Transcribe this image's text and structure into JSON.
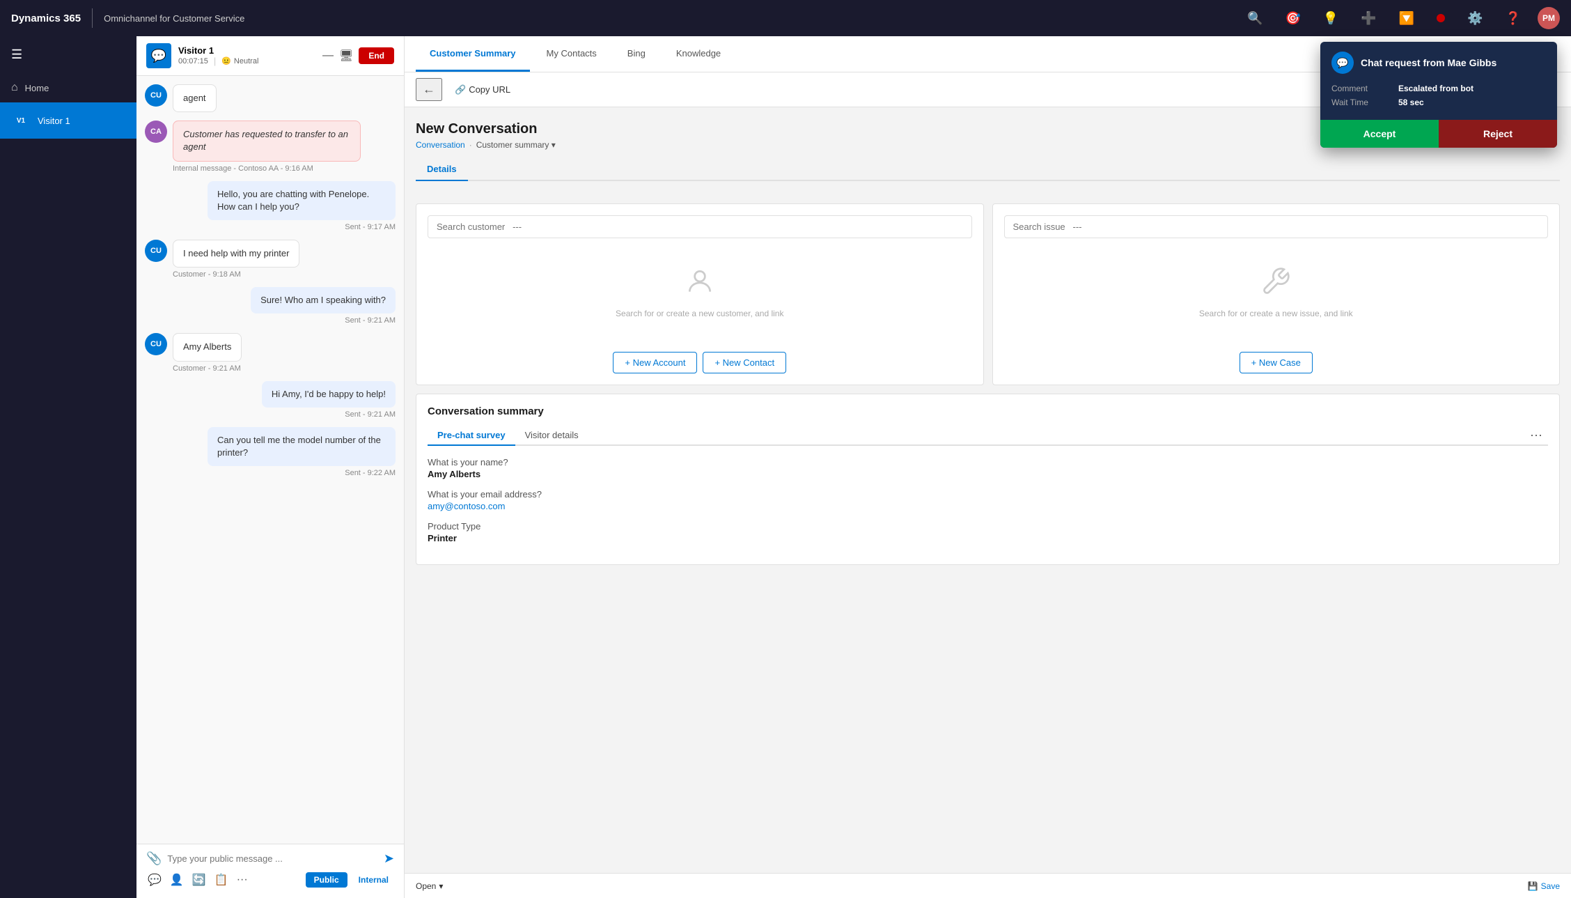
{
  "app": {
    "brand": "Dynamics 365",
    "app_name": "Omnichannel for Customer Service",
    "user_initials": "PM"
  },
  "sidebar": {
    "items": [
      {
        "label": "Home",
        "icon": "⌂",
        "active": false
      }
    ],
    "active_contact": "Visitor 1"
  },
  "conversation": {
    "visitor_name": "Visitor 1",
    "visitor_initials": "V1",
    "timer": "00:07:15",
    "sentiment": "Neutral",
    "messages": [
      {
        "type": "agent",
        "avatar": "CU",
        "avatar_bg": "#0078d4",
        "text": "agent",
        "time": "",
        "label": ""
      },
      {
        "type": "system",
        "avatar": "CA",
        "avatar_bg": "#9b59b6",
        "text": "Customer has requested to transfer to an agent",
        "time": "Internal message - Contoso AA - 9:16 AM",
        "label": ""
      },
      {
        "type": "agent",
        "avatar": "",
        "avatar_bg": "",
        "text": "Hello, you are chatting with Penelope. How can I help you?",
        "time": "Sent - 9:17 AM",
        "label": ""
      },
      {
        "type": "customer",
        "avatar": "CU",
        "avatar_bg": "#0078d4",
        "text": "I need help with my printer",
        "time": "Customer - 9:18 AM",
        "label": ""
      },
      {
        "type": "agent",
        "avatar": "",
        "avatar_bg": "",
        "text": "Sure! Who am I speaking with?",
        "time": "Sent - 9:21 AM",
        "label": ""
      },
      {
        "type": "customer",
        "avatar": "CU",
        "avatar_bg": "#0078d4",
        "text": "Amy Alberts",
        "time": "Customer - 9:21 AM",
        "label": ""
      },
      {
        "type": "agent",
        "avatar": "",
        "avatar_bg": "",
        "text": "Hi Amy, I'd be happy to help!",
        "time": "Sent - 9:21 AM",
        "label": ""
      },
      {
        "type": "agent",
        "avatar": "",
        "avatar_bg": "",
        "text": "Can you tell me the model number of the printer?",
        "time": "Sent - 9:22 AM",
        "label": ""
      }
    ],
    "input_placeholder": "Type your public message ...",
    "btn_end": "End",
    "btn_public": "Public",
    "btn_internal": "Internal"
  },
  "tabs": [
    {
      "label": "Customer Summary",
      "active": true
    },
    {
      "label": "My Contacts",
      "active": false
    },
    {
      "label": "Bing",
      "active": false
    },
    {
      "label": "Knowledge",
      "active": false
    }
  ],
  "main": {
    "page_title": "New Conversation",
    "breadcrumb_conversation": "Conversation",
    "breadcrumb_summary": "Customer summary",
    "sub_tabs": [
      {
        "label": "Details",
        "active": true
      }
    ],
    "toolbar_copy_url": "Copy URL",
    "customer_section": {
      "search_placeholder": "Search customer   ---",
      "empty_icon": "👤",
      "empty_text": "Search for or create a new customer, and link",
      "btn_new_account": "+ New Account",
      "btn_new_contact": "+ New Contact"
    },
    "issue_section": {
      "search_placeholder": "Search issue   ---",
      "empty_icon": "🔧",
      "empty_text": "Search for or create a new issue, and link",
      "btn_new_case": "+ New Case"
    },
    "conversation_summary": {
      "title": "Conversation summary",
      "tabs": [
        {
          "label": "Pre-chat survey",
          "active": true
        },
        {
          "label": "Visitor details",
          "active": false
        }
      ],
      "fields": [
        {
          "label": "What is your name?",
          "value": "Amy Alberts",
          "type": "bold"
        },
        {
          "label": "What is your email address?",
          "value": "amy@contoso.com",
          "type": "link"
        },
        {
          "label": "Product Type",
          "value": "Printer",
          "type": "bold"
        }
      ]
    }
  },
  "chat_request_popup": {
    "title": "Chat request from Mae Gibbs",
    "avatar_icon": "💬",
    "comment_label": "Comment",
    "comment_value": "Escalated from bot",
    "wait_time_label": "Wait Time",
    "wait_time_value": "58 sec",
    "btn_accept": "Accept",
    "btn_reject": "Reject"
  },
  "bottom_bar": {
    "status_open": "Open",
    "btn_save": "Save"
  }
}
